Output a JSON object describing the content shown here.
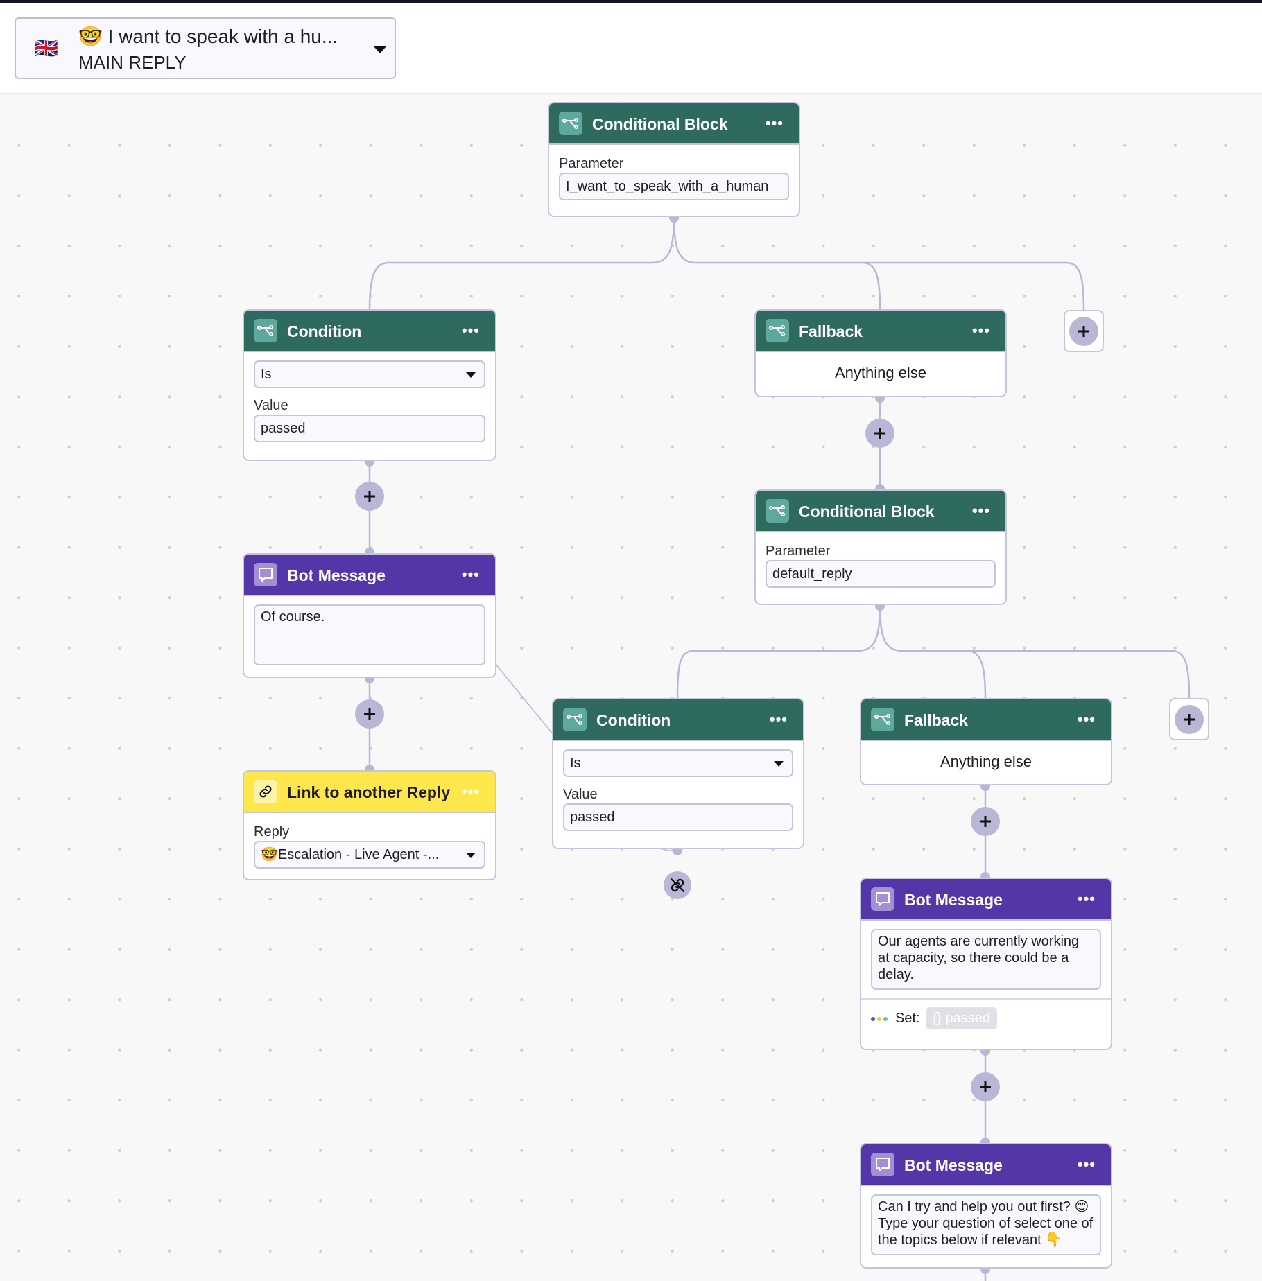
{
  "header": {
    "language_flag": "🇬🇧",
    "reply_emoji": "🤓",
    "reply_title": "I want to speak with a hu...",
    "reply_type": "MAIN REPLY"
  },
  "blocks": {
    "cond_block_1": {
      "title": "Conditional Block",
      "menu": "•••",
      "param_label": "Parameter",
      "param_value": "I_want_to_speak_with_a_human"
    },
    "condition_1": {
      "title": "Condition",
      "menu": "•••",
      "operator": "Is",
      "value_label": "Value",
      "value": "passed"
    },
    "bot_message_1": {
      "title": "Bot Message",
      "menu": "•••",
      "text": "Of course."
    },
    "link_reply": {
      "title": "Link to another Reply",
      "menu": "•••",
      "reply_label": "Reply",
      "reply_emoji": "🤓",
      "reply_value": "Escalation - Live Agent -..."
    },
    "fallback_1": {
      "title": "Fallback",
      "menu": "•••",
      "text": "Anything else"
    },
    "cond_block_2": {
      "title": "Conditional Block",
      "menu": "•••",
      "param_label": "Parameter",
      "param_value": "default_reply"
    },
    "condition_2": {
      "title": "Condition",
      "menu": "•••",
      "operator": "Is",
      "value_label": "Value",
      "value": "passed"
    },
    "fallback_2": {
      "title": "Fallback",
      "menu": "•••",
      "text": "Anything else"
    },
    "bot_message_2": {
      "title": "Bot Message",
      "menu": "•••",
      "text": "Our agents are currently working at capacity, so there could be a delay.",
      "set_label": "Set:",
      "set_chip": "{} passed"
    },
    "bot_message_3": {
      "title": "Bot Message",
      "menu": "•••",
      "text": "Can I try and help you out first? 😊 Type your question of select one of the topics below if relevant 👇"
    }
  },
  "colors": {
    "condition_header": "#2e6b5e",
    "bot_message_header": "#5536a8",
    "link_header": "#fde74c",
    "connector": "#b8b8d6"
  }
}
